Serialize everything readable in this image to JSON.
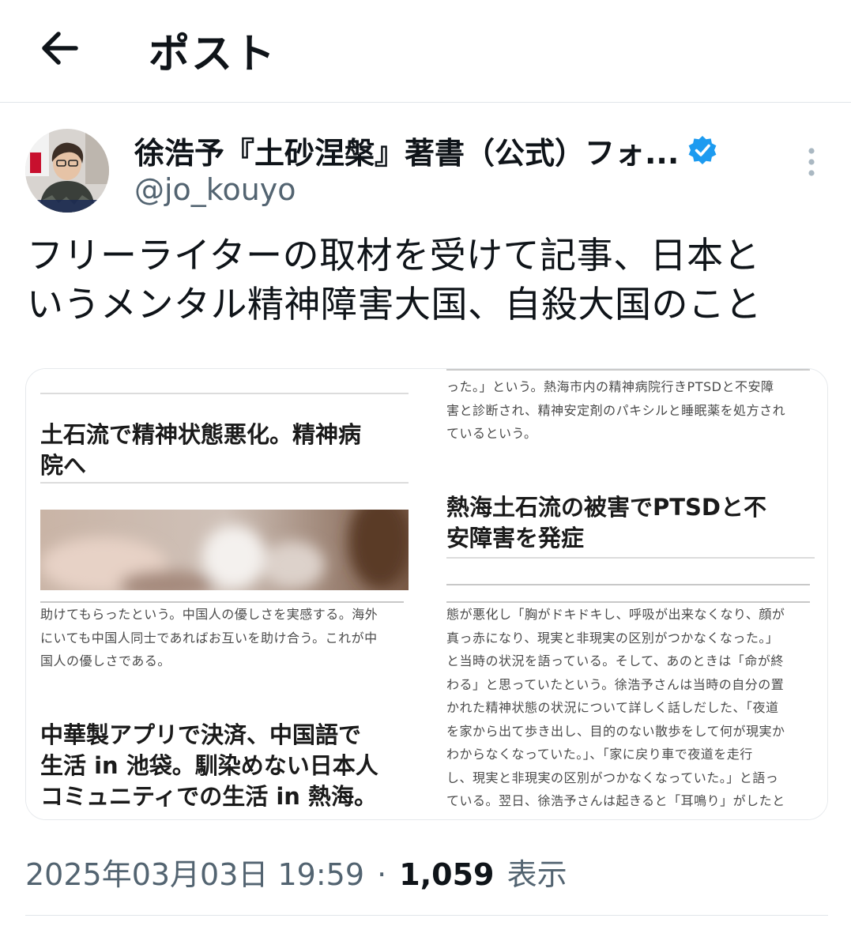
{
  "header": {
    "title": "ポスト",
    "back_icon": "arrow-left-icon"
  },
  "author": {
    "display_name": "徐浩予『土砂涅槃』著書（公式）フォ...",
    "handle": "@jo_kouyo",
    "verified_icon": "verified-badge-icon",
    "verified_color": "#1d9bf0",
    "more_icon": "more-vertical-icon"
  },
  "tweet": {
    "text_line1": "フリーライターの取材を受けて記事、日本と",
    "text_line2": "いうメンタル精神障害大国、自殺大国のこと"
  },
  "media": {
    "tile1": {
      "headline_line1": "土石流で精神状態悪化。精神病",
      "headline_line2": "院へ"
    },
    "tile2": {
      "body_line1": "った。」という。熱海市内の精神病院行きPTSDと不安障",
      "body_line2": "害と診断され、精神安定剤のパキシルと睡眠薬を処方され",
      "body_line3": "ているという。",
      "headline_line1": "熱海土石流の被害でPTSDと不",
      "headline_line2": "安障害を発症"
    },
    "tile3": {
      "body_line1": "助けてもらったという。中国人の優しさを実感する。海外",
      "body_line2": "にいても中国人同士であればお互いを助け合う。これが中",
      "body_line3": "国人の優しさである。",
      "headline_line1": "中華製アプリで決済、中国語で",
      "headline_line2": "生活 in 池袋。馴染めない日本人",
      "headline_line3": "コミュニティでの生活 in 熱海。"
    },
    "tile4": {
      "body_line1": "態が悪化し「胸がドキドキし、呼吸が出来なくなり、顔が",
      "body_line2": "真っ赤になり、現実と非現実の区別がつかなくなった。」",
      "body_line3": "と当時の状況を語っている。そして、あのときは「命が終",
      "body_line4": "わる」と思っていたという。徐浩予さんは当時の自分の置",
      "body_line5": "かれた精神状態の状況について詳しく話しだした、「夜道",
      "body_line6": "を家から出て歩き出し、目的のない散歩をして何が現実か",
      "body_line7": "わからなくなっていた。」、「家に戻り車で夜道を走行",
      "body_line8": "し、現実と非現実の区別がつかなくなっていた。」と語っ",
      "body_line9": "ている。翌日、徐浩予さんは起きると「耳鳴り」がしたと"
    }
  },
  "meta": {
    "timestamp": "2025年03月03日 19:59",
    "separator": "·",
    "views_count": "1,059",
    "views_label": "表示"
  }
}
